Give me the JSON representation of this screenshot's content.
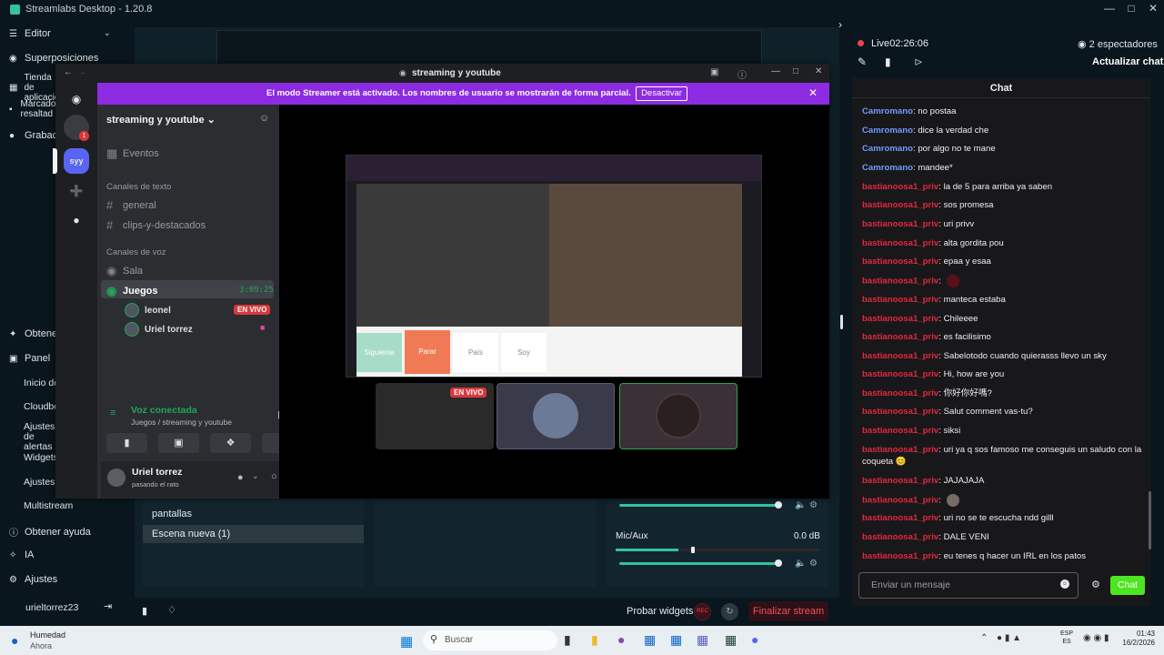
{
  "app": {
    "title": "Streamlabs Desktop - 1.20.8"
  },
  "sidebar": {
    "items": [
      {
        "label": "Editor",
        "icon": "layers-icon"
      },
      {
        "label": "Superposiciones",
        "icon": "overlay-icon"
      },
      {
        "label": "Tienda de aplicacio",
        "icon": "store-icon"
      },
      {
        "label": "Marcado resaltad",
        "icon": "highlight-icon"
      },
      {
        "label": "Grabaci",
        "icon": "record-icon"
      },
      {
        "label": "Obtener",
        "icon": "gift-icon"
      },
      {
        "label": "Panel",
        "icon": "dashboard-icon"
      }
    ],
    "panel_sub": [
      "Inicio de",
      "Cloudbo",
      "Ajustes de alertas",
      "Widgets",
      "Ajustes",
      "Multistream"
    ],
    "bottom": [
      {
        "label": "Obtener ayuda",
        "icon": "help-icon"
      },
      {
        "label": "IA",
        "icon": "ai-icon"
      },
      {
        "label": "Ajustes",
        "icon": "gear-icon"
      }
    ],
    "username": "urieltorrez23"
  },
  "scenes": {
    "items": [
      "pantallas",
      "Escena nueva (1)"
    ]
  },
  "mixer": {
    "source": "Mic/Aux",
    "db": "0.0 dB"
  },
  "footer": {
    "test_widgets": "Probar widgets",
    "rec": "REC",
    "end_stream": "Finalizar stream"
  },
  "stream": {
    "live_label": "Live",
    "time": "02:26:06",
    "viewers": "2 espectadores",
    "update_chat": "Actualizar chat"
  },
  "chat": {
    "header": "Chat",
    "messages": [
      {
        "user": "Camromano",
        "text": ": no postaa",
        "c": "cam"
      },
      {
        "user": "Camromano",
        "text": ": dice la verdad che",
        "c": "cam"
      },
      {
        "user": "Camromano",
        "text": ": por algo no te mane",
        "c": "cam"
      },
      {
        "user": "Camromano",
        "text": ": mandee*",
        "c": "cam"
      },
      {
        "user": "bastianoosa1_priv",
        "text": ": la de 5 para arriba ya saben",
        "c": "bas"
      },
      {
        "user": "bastianoosa1_priv",
        "text": ": sos promesa",
        "c": "bas"
      },
      {
        "user": "bastianoosa1_priv",
        "text": ": uri privv",
        "c": "bas"
      },
      {
        "user": "bastianoosa1_priv",
        "text": ": alta gordita pou",
        "c": "bas"
      },
      {
        "user": "bastianoosa1_priv",
        "text": ": epaa y esaa",
        "c": "bas"
      },
      {
        "user": "bastianoosa1_priv",
        "text": ":",
        "c": "bas",
        "emote": "#5a0f18"
      },
      {
        "user": "bastianoosa1_priv",
        "text": ": manteca estaba",
        "c": "bas"
      },
      {
        "user": "bastianoosa1_priv",
        "text": ": Chileeee",
        "c": "bas"
      },
      {
        "user": "bastianoosa1_priv",
        "text": ": es facilisimo",
        "c": "bas"
      },
      {
        "user": "bastianoosa1_priv",
        "text": ": Sabelotodo cuando quierasss llevo un sky",
        "c": "bas"
      },
      {
        "user": "bastianoosa1_priv",
        "text": ": Hi, how are you",
        "c": "bas"
      },
      {
        "user": "bastianoosa1_priv",
        "text": ": 你好你好嗎?",
        "c": "bas"
      },
      {
        "user": "bastianoosa1_priv",
        "text": ": Salut comment vas-tu?",
        "c": "bas"
      },
      {
        "user": "bastianoosa1_priv",
        "text": ": siksi",
        "c": "bas"
      },
      {
        "user": "bastianoosa1_priv",
        "text": ": uri ya q sos famoso me conseguis un saludo con la coqueta 😊",
        "c": "bas"
      },
      {
        "user": "bastianoosa1_priv",
        "text": ": JAJAJAJA",
        "c": "bas"
      },
      {
        "user": "bastianoosa1_priv",
        "text": ":",
        "c": "bas",
        "emote": "#7a6a64"
      },
      {
        "user": "bastianoosa1_priv",
        "text": ": uri no se te escucha ndd gilll",
        "c": "bas"
      },
      {
        "user": "bastianoosa1_priv",
        "text": ": DALE VENI",
        "c": "bas"
      },
      {
        "user": "bastianoosa1_priv",
        "text": ": eu tenes q hacer un IRL en los patos",
        "c": "bas"
      }
    ],
    "input_placeholder": "Enviar un mensaje",
    "send_label": "Chat"
  },
  "discord": {
    "title": "streaming y youtube",
    "banner_text": "El modo Streamer está activado. Los nombres de usuario se mostrarán de forma parcial.",
    "banner_button": "Desactivar",
    "server_name": "streaming y youtube",
    "server_badge": "syy",
    "notif_count": "1",
    "events": "Eventos",
    "text_cat": "Canales de texto",
    "text_channels": [
      "general",
      "clips-y-destacados"
    ],
    "voice_cat": "Canales de voz",
    "voice_channels": [
      "Sala",
      "Juegos"
    ],
    "voice_time": "3:09:25",
    "voice_users": [
      "leonel",
      "Uriel torrez"
    ],
    "live_badge": "EN VIVO",
    "vc_title": "Voz conectada",
    "vc_sub": "Juegos / streaming y youtube",
    "user_name": "Uriel torrez",
    "user_status": "pasando el rato",
    "stage_buttons": [
      "Siguiente",
      "Parar",
      "País",
      "Soy"
    ]
  },
  "taskbar": {
    "weather_title": "Humedad",
    "weather_sub": "Ahora",
    "search": "Buscar",
    "lang1": "ESP",
    "lang2": "ES",
    "time": "01:43",
    "date": "16/2/2026"
  }
}
